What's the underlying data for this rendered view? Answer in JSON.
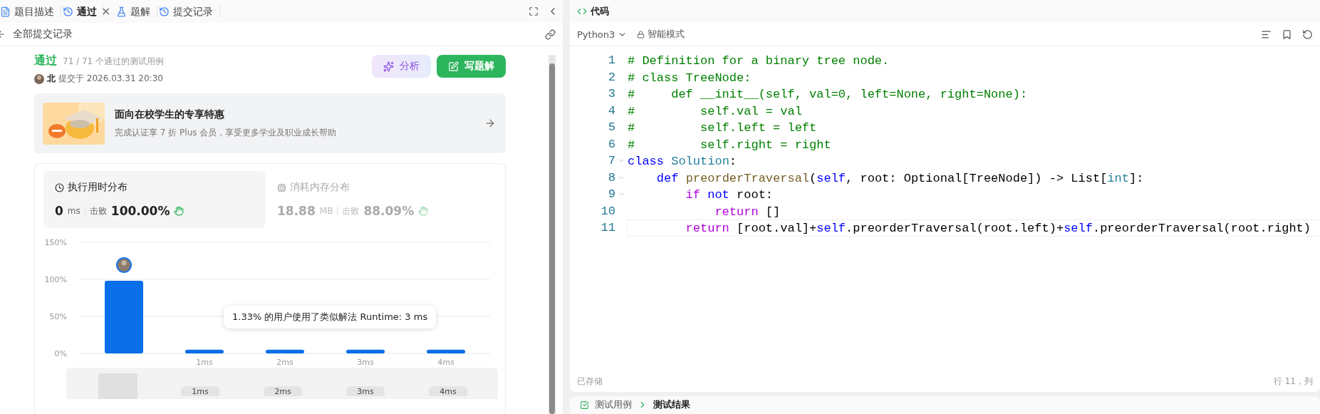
{
  "left_panel": {
    "tabs": [
      {
        "label": "题目描述",
        "selected": false
      },
      {
        "label": "通过",
        "selected": true,
        "close": "×"
      },
      {
        "label": "题解",
        "selected": false
      },
      {
        "label": "提交记录",
        "selected": false
      }
    ],
    "back_link": "全部提交记录",
    "submission": {
      "status": "通过",
      "cases": "71 / 71 个通过的测试用例",
      "user": "北",
      "submitted": "提交于 2026.03.31 20:30",
      "buttons": [
        {
          "label": "分析",
          "kind": "ai"
        },
        {
          "label": "写题解",
          "kind": "primary"
        }
      ]
    },
    "promo": {
      "title": "面向在校学生的专享特惠",
      "subtitle": "完成认证享 7 折 Plus 会员，享受更多学业及职业成长帮助"
    },
    "stats": [
      {
        "title": "执行用时分布",
        "selected": true,
        "value": "0",
        "unit": "ms",
        "beats_label": "击败",
        "beats": "100.00%"
      },
      {
        "title": "消耗内存分布",
        "selected": false,
        "value": "18.88",
        "unit": "MB",
        "beats_label": "击败",
        "beats": "88.09%"
      }
    ],
    "chart_data": {
      "type": "bar",
      "categories": [
        null,
        "1ms",
        "2ms",
        "3ms",
        "4ms"
      ],
      "values": [
        98,
        5,
        5,
        5,
        5
      ],
      "ylim": [
        0,
        150
      ],
      "yticks": [
        {
          "value": 0,
          "label": "0%"
        },
        {
          "value": 50,
          "label": "50%"
        },
        {
          "value": 100,
          "label": "100%"
        },
        {
          "value": 150,
          "label": "150%"
        }
      ]
    },
    "tooltip": "1.33% 的用户使用了类似解法 Runtime: 3 ms",
    "navigator_labels": [
      "1ms",
      "2ms",
      "3ms",
      "4ms"
    ]
  },
  "right_panel": {
    "title": "代码",
    "language": "Python3",
    "mode": "智能模式",
    "lines": [
      {
        "number": "1",
        "tokens": [
          {
            "text": "# Definition for a binary tree node.",
            "kind": "comment"
          }
        ]
      },
      {
        "number": "2",
        "tokens": [
          {
            "text": "# class TreeNode:",
            "kind": "comment"
          }
        ]
      },
      {
        "number": "3",
        "tokens": [
          {
            "text": "#     def __init__(self, val=0, left=None, right=None):",
            "kind": "comment"
          }
        ]
      },
      {
        "number": "4",
        "tokens": [
          {
            "text": "#         self.val = val",
            "kind": "comment"
          }
        ]
      },
      {
        "number": "5",
        "tokens": [
          {
            "text": "#         self.left = left",
            "kind": "comment"
          }
        ]
      },
      {
        "number": "6",
        "tokens": [
          {
            "text": "#         self.right = right",
            "kind": "comment"
          }
        ]
      },
      {
        "number": "7",
        "fold": true,
        "tokens": [
          {
            "text": "class ",
            "kind": "keyword"
          },
          {
            "text": "Solution",
            "kind": "type"
          },
          {
            "text": ":",
            "kind": "plain"
          }
        ]
      },
      {
        "number": "8",
        "fold": true,
        "tokens": [
          {
            "text": "    def ",
            "kind": "keyword"
          },
          {
            "text": "preorderTraversal",
            "kind": "func"
          },
          {
            "text": "(",
            "kind": "plain"
          },
          {
            "text": "self",
            "kind": "keyword"
          },
          {
            "text": ", root: Optional[TreeNode]) -> List[",
            "kind": "plain"
          },
          {
            "text": "int",
            "kind": "type"
          },
          {
            "text": "]:",
            "kind": "plain"
          }
        ]
      },
      {
        "number": "9",
        "fold": true,
        "tokens": [
          {
            "text": "        if ",
            "kind": "control"
          },
          {
            "text": "not",
            "kind": "keyword"
          },
          {
            "text": " root:",
            "kind": "plain"
          }
        ]
      },
      {
        "number": "10",
        "tokens": [
          {
            "text": "            return",
            "kind": "control"
          },
          {
            "text": " []",
            "kind": "plain"
          }
        ]
      },
      {
        "number": "11",
        "current": true,
        "tokens": [
          {
            "text": "        return",
            "kind": "control"
          },
          {
            "text": " [root.val]+",
            "kind": "plain"
          },
          {
            "text": "self",
            "kind": "keyword"
          },
          {
            "text": ".preorderTraversal(root.left)+",
            "kind": "plain"
          },
          {
            "text": "self",
            "kind": "keyword"
          },
          {
            "text": ".preorderTraversal(root.right)",
            "kind": "plain"
          }
        ]
      }
    ],
    "saved": "已存储",
    "position": "行 11，列",
    "bottom_tabs": [
      {
        "label": "测试用例",
        "selected": false
      },
      {
        "label": "测试结果",
        "selected": true
      }
    ]
  }
}
